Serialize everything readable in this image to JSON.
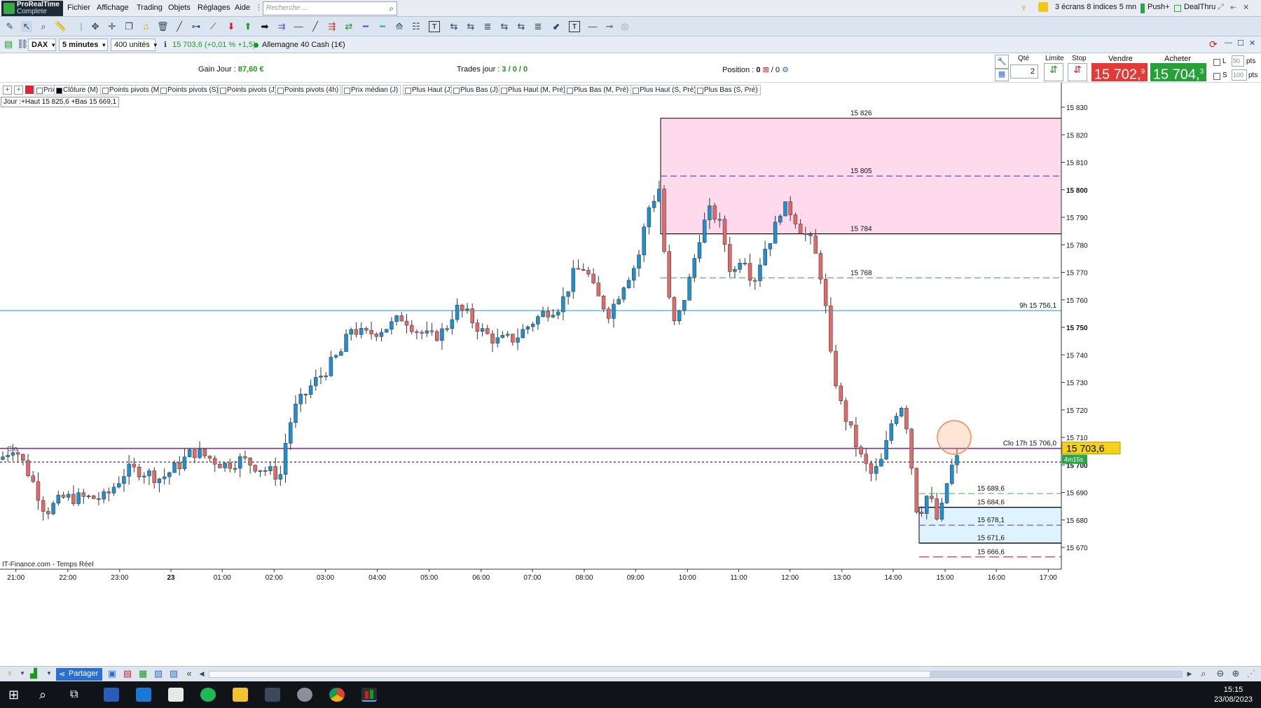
{
  "app": {
    "name": "ProRealTime",
    "edition": "Complete"
  },
  "menu": [
    "Fichier",
    "Affichage",
    "Trading",
    "Objets",
    "Réglages",
    "Aide"
  ],
  "search": {
    "placeholder": "Recherche ..."
  },
  "topright": {
    "layout": "3 écrans 8 indices 5 mn",
    "push": "Push+",
    "dealthru": "DealThru"
  },
  "instrument": {
    "symbol": "DAX",
    "timeframe": "5 minutes",
    "units": "400 unités",
    "quote": "15 703,6 (+0,01 % +1,5)",
    "name": "Allemagne 40 Cash (1€)"
  },
  "trade": {
    "gain_label": "Gain Jour :",
    "gain_value": "87,60 €",
    "trades_label": "Trades jour :",
    "trades_value": "3 / 0 / 0",
    "position_label": "Position :",
    "position_value": "0",
    "position_pending": "/ 0",
    "qty_label": "Qté",
    "qty_value": "2",
    "limit_label": "Limite",
    "stop_label": "Stop",
    "sell_label": "Vendre",
    "sell_price": "15 702,",
    "sell_sup": "9",
    "buy_label": "Acheter",
    "buy_price": "15 704,",
    "buy_sup": "3",
    "l_label": "L",
    "l_value": "90",
    "s_label": "S",
    "s_value": "100",
    "pts": "pts"
  },
  "indicators": [
    "Prix",
    "Clôture (M)",
    "Points pivots (M)",
    "Points pivots (S)",
    "Points pivots (J)",
    "Points pivots (4h)",
    "Prix médian (J)",
    "Plus Haut (J)",
    "Plus Bas (J)",
    "Plus Haut (M, Pré)",
    "Plus Bas (M, Pré)",
    "Plus Haut (S, Pré)",
    "Plus Bas (S, Pré)"
  ],
  "jour_label": "Jour :+Haut 15 825,6 +Bas 15 669,1",
  "chart_data": {
    "type": "candlestick",
    "instrument": "DAX",
    "timeframe": "5 minutes",
    "x_ticks": [
      "21:00",
      "22:00",
      "23:00",
      "23",
      "01:00",
      "02:00",
      "03:00",
      "04:00",
      "05:00",
      "06:00",
      "07:00",
      "08:00",
      "09:00",
      "10:00",
      "11:00",
      "12:00",
      "13:00",
      "14:00",
      "15:00",
      "16:00",
      "17:00"
    ],
    "y_ticks": [
      15670,
      15680,
      15690,
      15700,
      15710,
      15720,
      15730,
      15740,
      15750,
      15760,
      15770,
      15780,
      15790,
      15800,
      15810,
      15820,
      15830
    ],
    "y_tick_labels": [
      "15 670",
      "15 680",
      "15 690",
      "15 700",
      "15 710",
      "15 720",
      "15 730",
      "15 740",
      "15 750",
      "15 760",
      "15 770",
      "15 780",
      "15 790",
      "15 800",
      "15 810",
      "15 820",
      "15 830"
    ],
    "ylim": [
      15665,
      15835
    ],
    "current_price": 15703.6,
    "current_price_label": "15 703,6",
    "countdown": "4m15s",
    "price_line_label": "Clo",
    "zones": [
      {
        "name": "resistance-zone",
        "top": 15826,
        "bottom": 15784,
        "color": "#ffd9ec"
      },
      {
        "name": "support-zone",
        "top": 15684.6,
        "bottom": 15671.6,
        "color": "#dff2ff"
      }
    ],
    "levels": [
      {
        "value": 15826,
        "label": "15 826",
        "style": "none",
        "color": "#000000"
      },
      {
        "value": 15805,
        "label": "15 805",
        "style": "dashed",
        "color": "#5b4fd6"
      },
      {
        "value": 15784,
        "label": "15 784",
        "style": "solid",
        "color": "#000000"
      },
      {
        "value": 15768,
        "label": "15 768",
        "style": "dashed",
        "color": "#5cb85c"
      },
      {
        "value": 15756.1,
        "label": "9h 15 756,1",
        "style": "solid",
        "color": "#27a9c7"
      },
      {
        "value": 15706,
        "label": "Clo 17h 15 706,0",
        "style": "solid",
        "color": "#8a2aa6"
      },
      {
        "value": 15689.6,
        "label": "15 689,6",
        "style": "dashed",
        "color": "#5cb85c"
      },
      {
        "value": 15684.6,
        "label": "15 684,6",
        "style": "solid",
        "color": "#000000"
      },
      {
        "value": 15678.1,
        "label": "15 678,1",
        "style": "dashed",
        "color": "#5b4fd6"
      },
      {
        "value": 15671.6,
        "label": "15 671,6",
        "style": "solid",
        "color": "#000000"
      },
      {
        "value": 15666.6,
        "label": "15 666,6",
        "style": "dashed",
        "color": "#e53935"
      }
    ],
    "price_anchors": [
      [
        0,
        15702
      ],
      [
        20,
        15707
      ],
      [
        45,
        15695
      ],
      [
        65,
        15683
      ],
      [
        90,
        15688
      ],
      [
        120,
        15688
      ],
      [
        150,
        15688
      ],
      [
        180,
        15698
      ],
      [
        200,
        15698
      ],
      [
        230,
        15695
      ],
      [
        255,
        15700
      ],
      [
        275,
        15705
      ],
      [
        295,
        15703
      ],
      [
        320,
        15700
      ],
      [
        345,
        15702
      ],
      [
        380,
        15698
      ],
      [
        400,
        15696
      ],
      [
        410,
        15712
      ],
      [
        420,
        15720
      ],
      [
        445,
        15729
      ],
      [
        470,
        15736
      ],
      [
        490,
        15742
      ],
      [
        500,
        15750
      ],
      [
        520,
        15747
      ],
      [
        540,
        15749
      ],
      [
        560,
        15751
      ],
      [
        575,
        15754
      ],
      [
        595,
        15749
      ],
      [
        615,
        15746
      ],
      [
        635,
        15749
      ],
      [
        650,
        15757
      ],
      [
        665,
        15755
      ],
      [
        690,
        15748
      ],
      [
        710,
        15745
      ],
      [
        735,
        15746
      ],
      [
        760,
        15752
      ],
      [
        780,
        15756
      ],
      [
        800,
        15758
      ],
      [
        820,
        15770
      ],
      [
        835,
        15772
      ],
      [
        850,
        15762
      ],
      [
        870,
        15755
      ],
      [
        890,
        15766
      ],
      [
        910,
        15774
      ],
      [
        925,
        15793
      ],
      [
        942,
        15801
      ],
      [
        950,
        15770
      ],
      [
        960,
        15750
      ],
      [
        970,
        15755
      ],
      [
        985,
        15768
      ],
      [
        1000,
        15785
      ],
      [
        1015,
        15793
      ],
      [
        1030,
        15786
      ],
      [
        1045,
        15768
      ],
      [
        1060,
        15778
      ],
      [
        1075,
        15766
      ],
      [
        1090,
        15778
      ],
      [
        1105,
        15785
      ],
      [
        1115,
        15794
      ],
      [
        1130,
        15792
      ],
      [
        1145,
        15785
      ],
      [
        1160,
        15780
      ],
      [
        1175,
        15766
      ],
      [
        1185,
        15740
      ],
      [
        1200,
        15722
      ],
      [
        1215,
        15712
      ],
      [
        1230,
        15702
      ],
      [
        1245,
        15696
      ],
      [
        1260,
        15702
      ],
      [
        1275,
        15718
      ],
      [
        1290,
        15723
      ],
      [
        1300,
        15702
      ],
      [
        1310,
        15681
      ],
      [
        1325,
        15690
      ],
      [
        1340,
        15678
      ],
      [
        1350,
        15692
      ],
      [
        1362,
        15702
      ]
    ],
    "candle_count": 190,
    "x_range": [
      0,
      1515
    ]
  },
  "source_label": "IT-Finance.com - Temps Réel",
  "bottom": {
    "share": "Partager"
  },
  "clock": {
    "time": "15:15",
    "date": "23/08/2023"
  }
}
